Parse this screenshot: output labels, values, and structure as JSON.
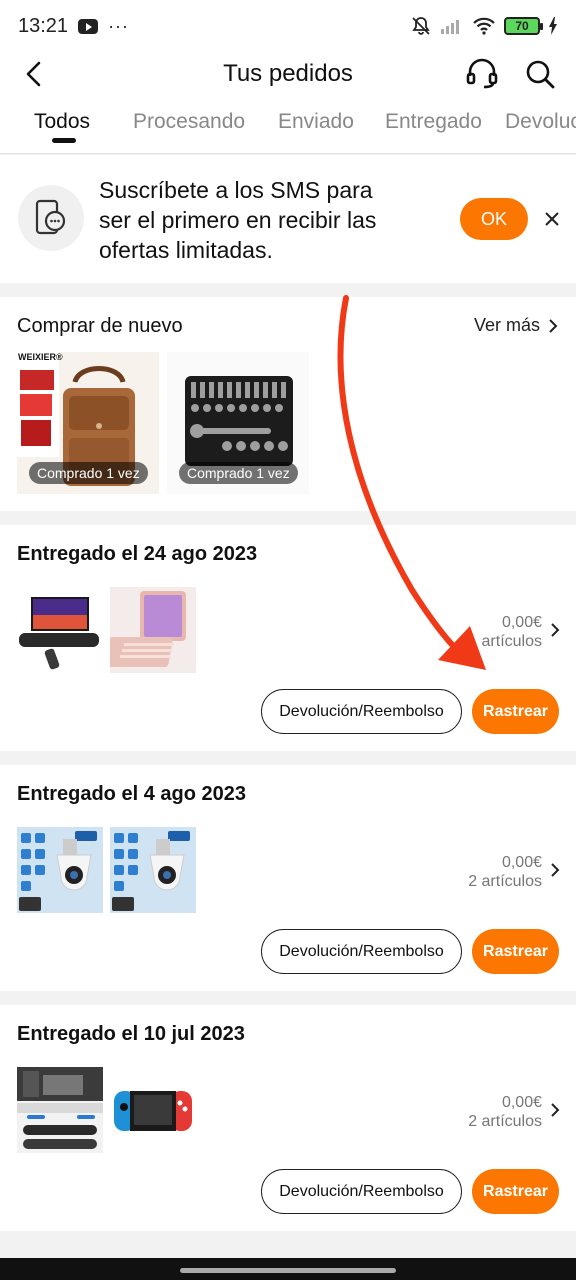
{
  "status_bar": {
    "time": "13:21",
    "dots": "···",
    "battery": "70"
  },
  "header": {
    "title": "Tus pedidos"
  },
  "tabs": [
    {
      "label": "Todos"
    },
    {
      "label": "Procesando"
    },
    {
      "label": "Enviado"
    },
    {
      "label": "Entregado"
    },
    {
      "label": "Devoluc"
    }
  ],
  "sms_banner": {
    "line1": "Suscríbete a los SMS para",
    "line2": "ser el primero en recibir las",
    "line3": "ofertas limitadas.",
    "ok_label": "OK"
  },
  "buy_again": {
    "title": "Comprar de nuevo",
    "see_more": "Ver más",
    "items": [
      {
        "badge": "Comprado 1 vez",
        "brand": "WEIXIER®"
      },
      {
        "badge": "Comprado 1 vez"
      }
    ]
  },
  "orders": [
    {
      "title": "Entregado el 24 ago 2023",
      "price": "0,00€",
      "count": "artículos",
      "return_label": "Devolución/Reembolso",
      "track_label": "Rastrear"
    },
    {
      "title": "Entregado el 4 ago 2023",
      "price": "0,00€",
      "count": "2 artículos",
      "return_label": "Devolución/Reembolso",
      "track_label": "Rastrear"
    },
    {
      "title": "Entregado el 10 jul 2023",
      "price": "0,00€",
      "count": "2 artículos",
      "return_label": "Devolución/Reembolso",
      "track_label": "Rastrear"
    }
  ],
  "colors": {
    "accent": "#fb7701",
    "annotation_arrow": "#f03a17"
  }
}
